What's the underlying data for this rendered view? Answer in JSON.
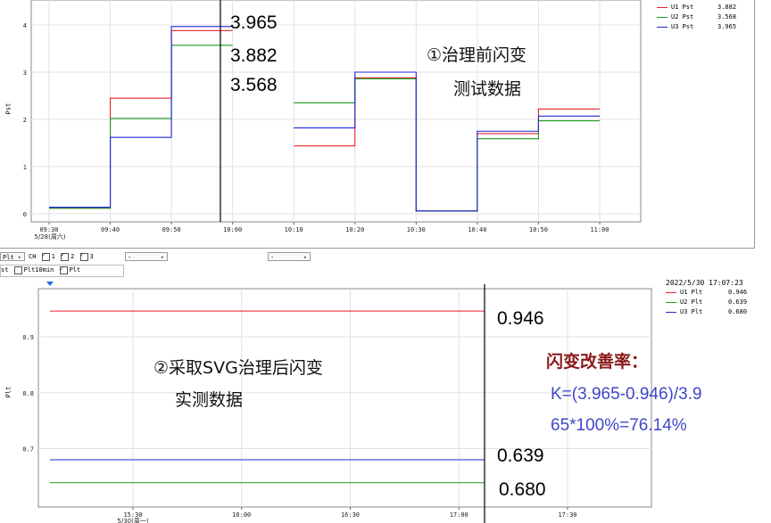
{
  "chart_data": [
    {
      "type": "line",
      "step": true,
      "ylabel": "Pst",
      "ylim": [
        0,
        4.2
      ],
      "yticks": [
        "0",
        "1",
        "2",
        "3",
        "4"
      ],
      "xticks": [
        "09:30",
        "09:40",
        "09:50",
        "10:00",
        "10:10",
        "10:20",
        "10:30",
        "10:40",
        "10:50",
        "11:00"
      ],
      "x_date_label": "5/28(周六)",
      "segments_time": [
        [
          "09:30",
          "09:40"
        ],
        [
          "09:40",
          "09:50"
        ],
        [
          "09:50",
          "10:00"
        ],
        [
          "10:10",
          "10:20"
        ],
        [
          "10:20",
          "10:30"
        ],
        [
          "10:30",
          "10:40"
        ],
        [
          "10:40",
          "10:50"
        ],
        [
          "10:50",
          "11:00"
        ]
      ],
      "series": [
        {
          "name": "U1 Pst",
          "color": "#e8202a",
          "values": [
            0.12,
            2.45,
            3.88,
            1.44,
            2.88,
            0.06,
            1.7,
            2.22
          ]
        },
        {
          "name": "U2 Pst",
          "color": "#1f9a1f",
          "values": [
            0.12,
            2.02,
            3.57,
            2.35,
            2.86,
            0.06,
            1.59,
            1.97
          ]
        },
        {
          "name": "U3 Pst",
          "color": "#1e28d8",
          "values": [
            0.14,
            1.62,
            3.965,
            1.82,
            3.0,
            0.06,
            1.75,
            2.07
          ]
        }
      ],
      "legend_values": [
        "3.882",
        "3.568",
        "3.965"
      ],
      "cursor_time": "09:58",
      "annotations": [
        "3.965",
        "3.882",
        "3.568"
      ],
      "note_lines": [
        "①治理前闪变",
        "测试数据"
      ],
      "grid": true,
      "legend": "top-right"
    },
    {
      "type": "line",
      "ylabel": "Plt",
      "ylim": [
        0.6,
        1.0
      ],
      "yticks": [
        "0.7",
        "0.8",
        "0.9"
      ],
      "xticks": [
        "15:30",
        "16:00",
        "16:30",
        "17:00",
        "17:30"
      ],
      "x_date_label": "5/30(周一)",
      "timestamp": "2022/5/30 17:07:23",
      "series": [
        {
          "name": "U1 Plt",
          "color": "#e8202a",
          "values": [
            0.946,
            0.946
          ]
        },
        {
          "name": "U2 Plt",
          "color": "#1f9a1f",
          "values": [
            0.639,
            0.639
          ]
        },
        {
          "name": "U3 Plt",
          "color": "#1e28d8",
          "values": [
            0.68,
            0.68
          ]
        }
      ],
      "legend_values": [
        "0.946",
        "0.639",
        "0.680"
      ],
      "annotations": [
        "0.946",
        "0.639",
        "0.680"
      ],
      "note_lines": [
        "②采取SVG治理后闪变",
        "实测数据"
      ],
      "grid": true,
      "legend": "top-right"
    }
  ],
  "toolbar": {
    "select_value": "Plt",
    "ch_label": "CH",
    "ch1": "1",
    "ch2": "2",
    "ch3": "3",
    "dropdown1": "-",
    "dropdown2": "-",
    "opt_st": "st",
    "opt_plt10": "Plt10min",
    "opt_plt": "Plt"
  },
  "improvement": {
    "title": "闪变改善率：",
    "line1": "K=(3.965-0.946)/3.9",
    "line2": "65*100%=76.14%",
    "title_color": "#8b1a1a",
    "formula_color": "#3f47c9"
  }
}
